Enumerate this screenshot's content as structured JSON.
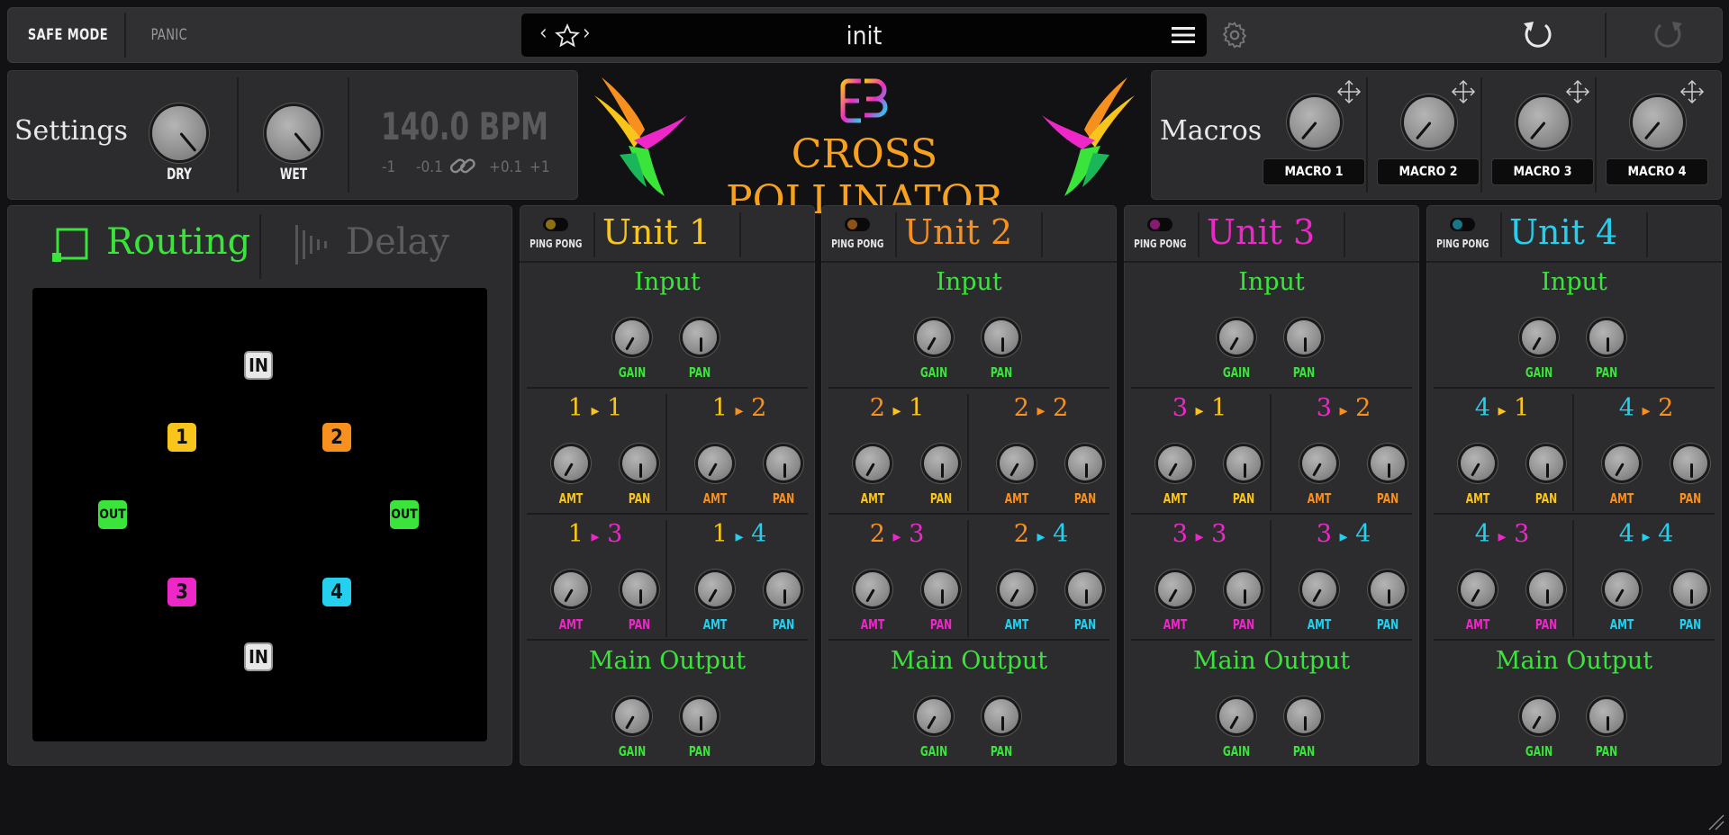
{
  "top": {
    "safe_mode": "SAFE MODE",
    "panic": "PANIC",
    "preset_name": "init",
    "nav_prev": "‹",
    "nav_next": "›"
  },
  "settings": {
    "title": "Settings",
    "dry_label": "DRY",
    "wet_label": "WET",
    "bpm": "140.0 BPM",
    "nudges": [
      "-1",
      "-0.1",
      "+0.1",
      "+1"
    ]
  },
  "logo": {
    "title": "CROSS POLLINATOR"
  },
  "macros": {
    "title": "Macros",
    "labels": [
      "MACRO 1",
      "MACRO 2",
      "MACRO 3",
      "MACRO 4"
    ]
  },
  "tabs": {
    "routing": "Routing",
    "delay": "Delay"
  },
  "routing": {
    "nodes": {
      "in": "IN",
      "out": "OUT",
      "u1": "1",
      "u2": "2",
      "u3": "3",
      "u4": "4"
    }
  },
  "labels": {
    "ping_pong": "PING PONG",
    "input": "Input",
    "main_output": "Main Output",
    "gain": "GAIN",
    "pan": "PAN",
    "amt": "AMT",
    "arrow": "▸"
  },
  "colors": {
    "u1": "#f8c51c",
    "u2": "#f7901e",
    "u3": "#ee28c8",
    "u4": "#24d0ee",
    "green": "#3ae43a"
  },
  "units": [
    {
      "title": "Unit 1",
      "num": "1"
    },
    {
      "title": "Unit 2",
      "num": "2"
    },
    {
      "title": "Unit 3",
      "num": "3"
    },
    {
      "title": "Unit 4",
      "num": "4"
    }
  ]
}
